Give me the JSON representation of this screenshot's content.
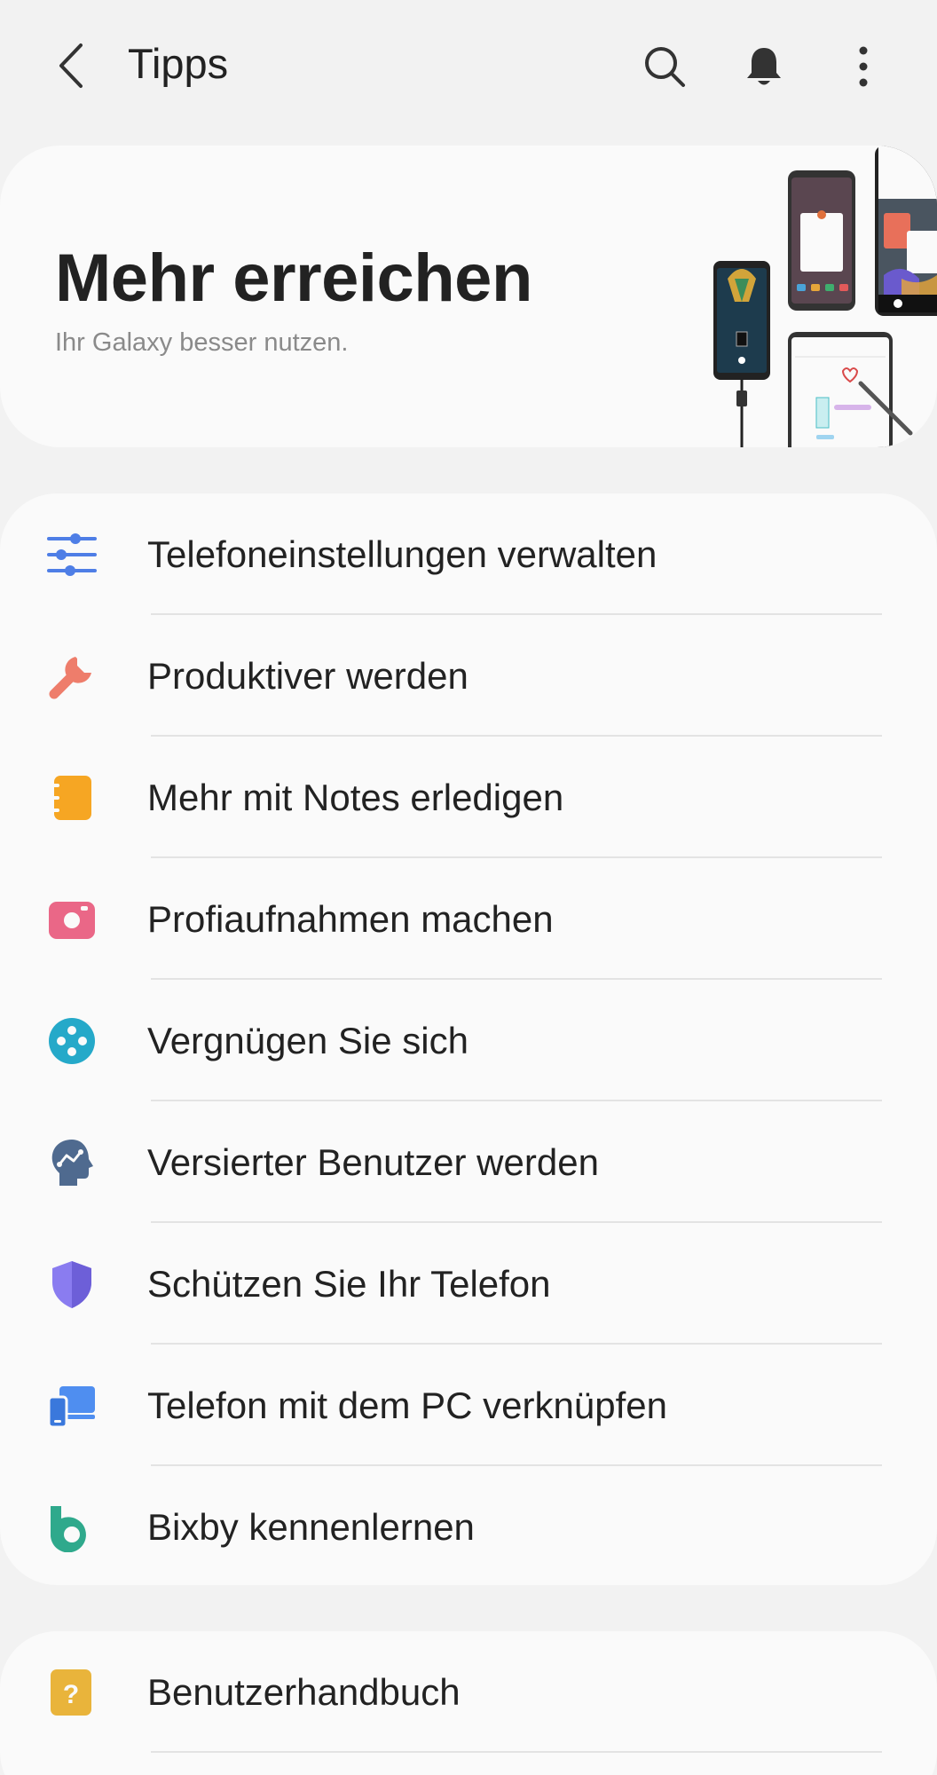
{
  "header": {
    "title": "Tipps",
    "icons": [
      "back-icon",
      "search-icon",
      "bell-icon",
      "more-icon"
    ]
  },
  "hero": {
    "title": "Mehr erreichen",
    "subtitle": "Ihr Galaxy besser nutzen."
  },
  "main_list": {
    "items": [
      {
        "label": "Telefoneinstellungen verwalten",
        "icon": "sliders-icon",
        "color": "#4e7ee6"
      },
      {
        "label": "Produktiver werden",
        "icon": "wrench-icon",
        "color": "#ee7d6b"
      },
      {
        "label": "Mehr mit Notes erledigen",
        "icon": "notes-icon",
        "color": "#f6a623"
      },
      {
        "label": "Profiaufnahmen machen",
        "icon": "camera-icon",
        "color": "#ea6787"
      },
      {
        "label": "Vergnügen Sie sich",
        "icon": "gamepad-icon",
        "color": "#25a9c9"
      },
      {
        "label": "Versierter Benutzer werden",
        "icon": "head-icon",
        "color": "#4f6a8f"
      },
      {
        "label": "Schützen Sie Ihr Telefon",
        "icon": "shield-icon",
        "color": "#8a7cf0"
      },
      {
        "label": "Telefon mit dem PC verknüpfen",
        "icon": "devices-icon",
        "color": "#4f8ef0"
      },
      {
        "label": "Bixby kennenlernen",
        "icon": "bixby-icon",
        "color": "#2fa98c"
      }
    ]
  },
  "second_list": {
    "items": [
      {
        "label": "Benutzerhandbuch",
        "icon": "help-icon",
        "color": "#e9b43b"
      }
    ]
  }
}
